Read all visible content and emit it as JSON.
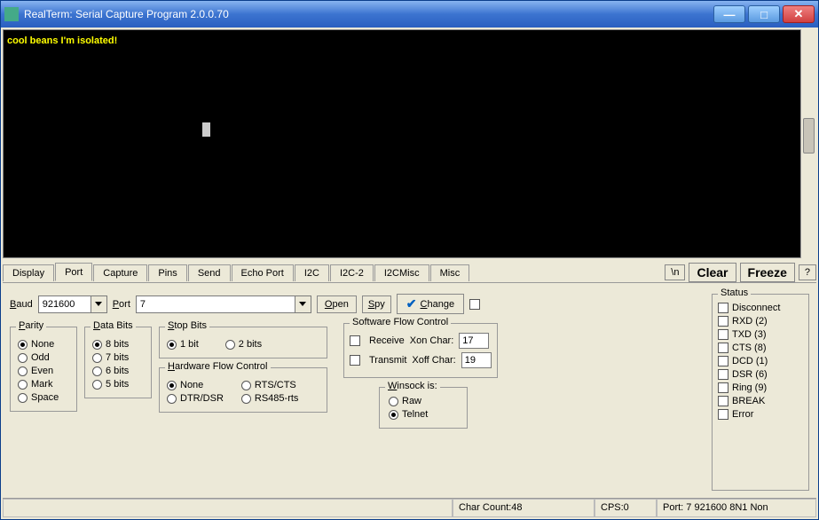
{
  "titlebar": {
    "title": "RealTerm: Serial Capture Program 2.0.0.70"
  },
  "terminal": {
    "text": "cool beans I'm isolated!"
  },
  "tabs": [
    "Display",
    "Port",
    "Capture",
    "Pins",
    "Send",
    "Echo Port",
    "I2C",
    "I2C-2",
    "I2CMisc",
    "Misc"
  ],
  "active_tab_index": 1,
  "tabbar_right": {
    "newline": "\\n",
    "clear": "Clear",
    "freeze": "Freeze",
    "help": "?"
  },
  "port_panel": {
    "baud_label": "Baud",
    "baud_value": "921600",
    "port_label": "Port",
    "port_value": "7",
    "open_label": "Open",
    "spy_label": "Spy",
    "change_label": "Change"
  },
  "parity": {
    "title": "Parity",
    "options": [
      "None",
      "Odd",
      "Even",
      "Mark",
      "Space"
    ],
    "selected": 0
  },
  "databits": {
    "title": "Data Bits",
    "options": [
      "8 bits",
      "7 bits",
      "6 bits",
      "5 bits"
    ],
    "selected": 0
  },
  "stopbits": {
    "title": "Stop Bits",
    "options": [
      "1 bit",
      "2 bits"
    ],
    "selected": 0
  },
  "hwflow": {
    "title": "Hardware Flow Control",
    "options": [
      "None",
      "RTS/CTS",
      "DTR/DSR",
      "RS485-rts"
    ],
    "selected": 0
  },
  "swflow": {
    "title": "Software Flow Control",
    "receive_label": "Receive",
    "xon_label": "Xon Char:",
    "xon_value": "17",
    "transmit_label": "Transmit",
    "xoff_label": "Xoff Char:",
    "xoff_value": "19"
  },
  "winsock": {
    "title": "Winsock is:",
    "options": [
      "Raw",
      "Telnet"
    ],
    "selected": 1
  },
  "status": {
    "title": "Status",
    "items": [
      "Disconnect",
      "RXD (2)",
      "TXD (3)",
      "CTS (8)",
      "DCD (1)",
      "DSR (6)",
      "Ring (9)",
      "BREAK",
      "Error"
    ]
  },
  "statusbar": {
    "charcount": "Char Count:48",
    "cps": "CPS:0",
    "port": "Port: 7 921600 8N1 Non"
  }
}
